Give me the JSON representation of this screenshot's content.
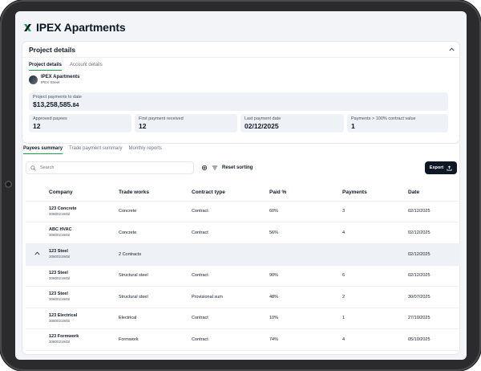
{
  "app": {
    "title": "IPEX Apartments"
  },
  "project_section": {
    "title": "Project details",
    "tabs": [
      "Project details",
      "Account details"
    ],
    "project_name": "IPEX Apartments",
    "project_address": "IPEX Street",
    "payments_to_date": {
      "label": "Project payments to date",
      "value_main": "$13,258,585.",
      "value_cents": "84"
    },
    "stats": [
      {
        "label": "Approved payees",
        "value": "12"
      },
      {
        "label": "First payment received",
        "value": "12"
      },
      {
        "label": "Last payment date",
        "value": "02/12/2025"
      },
      {
        "label": "Payments > 100% contract value",
        "value": "1"
      }
    ]
  },
  "payees_section": {
    "tabs": [
      "Payees summary",
      "Trade payment summary",
      "Monthly reports"
    ],
    "search_placeholder": "Search",
    "reset_label": "Reset sorting",
    "export_label": "Export",
    "columns": [
      "Company",
      "Trade works",
      "Contract type",
      "Paid %",
      "Payments",
      "Date"
    ],
    "rows": [
      {
        "company": "123 Concrete",
        "number": "3080021945l",
        "trade": "Concrete",
        "contract": "Contract",
        "paid": "60%",
        "payments": "3",
        "date": "02/12/2025"
      },
      {
        "company": "ABC HVAC",
        "number": "3080021945l",
        "trade": "Concrete",
        "contract": "Contract",
        "paid": "56%",
        "payments": "4",
        "date": "02/12/2025"
      }
    ],
    "group": {
      "company": "123 Steel",
      "number": "3080021945l",
      "trade": "2 Contracts",
      "date": "02/12/2025"
    },
    "group_rows": [
      {
        "company": "123 Steel",
        "number": "3080021945l",
        "trade": "Structural steel",
        "contract": "Contract",
        "paid": "90%",
        "payments": "6",
        "date": "02/12/2025"
      },
      {
        "company": "123 Steel",
        "number": "3080021945l",
        "trade": "Structural steel",
        "contract": "Provisional sum",
        "paid": "48%",
        "payments": "2",
        "date": "30/07/2025"
      }
    ],
    "rows_after": [
      {
        "company": "123 Electrical",
        "number": "3080021945l",
        "trade": "Electrical",
        "contract": "Contract",
        "paid": "10%",
        "payments": "1",
        "date": "27/10/2025"
      },
      {
        "company": "123 Formwork",
        "number": "3080021945l",
        "trade": "Formwork",
        "contract": "Contract",
        "paid": "74%",
        "payments": "4",
        "date": "05/10/2025"
      }
    ]
  },
  "colors": {
    "accent": "#16a34a",
    "dark": "#0d1726",
    "panel": "#eef1f6"
  }
}
